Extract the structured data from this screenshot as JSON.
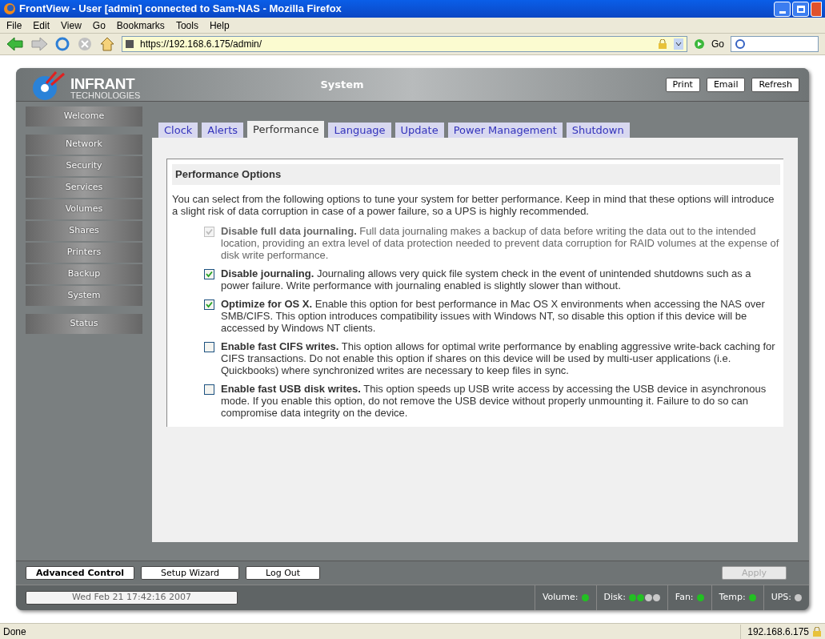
{
  "window": {
    "title": "FrontView - User [admin] connected to Sam-NAS - Mozilla Firefox"
  },
  "menu": [
    "File",
    "Edit",
    "View",
    "Go",
    "Bookmarks",
    "Tools",
    "Help"
  ],
  "address_bar": {
    "value": "https://192.168.6.175/admin/",
    "go": "Go"
  },
  "logo": {
    "name": "INFRANT",
    "sub": "TECHNOLOGIES"
  },
  "header": {
    "title": "System",
    "buttons": [
      "Print",
      "Email",
      "Refresh"
    ]
  },
  "sidebar": {
    "groups": [
      {
        "items": [
          {
            "label": "Welcome"
          }
        ]
      },
      {
        "items": [
          {
            "label": "Network"
          },
          {
            "label": "Security"
          },
          {
            "label": "Services"
          },
          {
            "label": "Volumes"
          },
          {
            "label": "Shares"
          },
          {
            "label": "Printers"
          },
          {
            "label": "Backup"
          },
          {
            "label": "System"
          }
        ]
      },
      {
        "items": [
          {
            "label": "Status"
          }
        ]
      }
    ]
  },
  "tabs": [
    {
      "label": "Clock",
      "selected": false
    },
    {
      "label": "Alerts",
      "selected": false
    },
    {
      "label": "Performance",
      "selected": true
    },
    {
      "label": "Language",
      "selected": false
    },
    {
      "label": "Update",
      "selected": false
    },
    {
      "label": "Power Management",
      "selected": false
    },
    {
      "label": "Shutdown",
      "selected": false
    }
  ],
  "section": {
    "title": "Performance Options",
    "intro": "You can select from the following options to tune your system for better performance. Keep in mind that these options will introduce a slight risk of data corruption in case of a power failure, so a UPS is highly recommended."
  },
  "options": [
    {
      "text": "**Disable full data journaling.** Full data journaling makes a backup of data before writing the data out to the intended location, providing an extra level of data protection needed to prevent data corruption for RAID volumes at the expense of disk write performance.",
      "checked": true,
      "disabled": true
    },
    {
      "text": "**Disable journaling.** Journaling allows very quick file system check in the event of unintended shutdowns such as a power failure. Write performance with journaling enabled is slightly slower than without.",
      "checked": true,
      "disabled": false
    },
    {
      "text": "**Optimize for OS X.** Enable this option for best performance in Mac OS X environments when accessing the NAS over SMB/CIFS. This option introduces compatibility issues with Windows NT, so disable this option if this device will be accessed by Windows NT clients.",
      "checked": true,
      "disabled": false
    },
    {
      "text": "**Enable fast CIFS writes.** This option allows for optimal write performance by enabling aggressive write-back caching for CIFS transactions. Do not enable this option if shares on this device will be used by multi-user applications (i.e. Quickbooks) where synchronized writes are necessary to keep files in sync.",
      "checked": false,
      "disabled": false
    },
    {
      "text": "**Enable fast USB disk writes.** This option speeds up USB write access by accessing the USB device in asynchronous mode. If you enable this option, do not remove the USB device without properly unmounting it. Failure to do so can compromise data integrity on the device.",
      "checked": false,
      "disabled": false
    }
  ],
  "footer_buttons": [
    {
      "label": "Advanced Control",
      "selected": true
    },
    {
      "label": "Setup Wizard",
      "selected": false
    },
    {
      "label": "Log Out",
      "selected": false
    }
  ],
  "apply": {
    "label": "Apply",
    "disabled": true
  },
  "datetime": "Wed Feb 21 17:42:16 2007",
  "indicators": [
    {
      "label": "Volume:",
      "dots": [
        {
          "color": "#22c022"
        }
      ]
    },
    {
      "label": "Disk:",
      "dots": [
        {
          "color": "#22c022"
        },
        {
          "color": "#22c022"
        },
        {
          "color": "#c8c8c8"
        },
        {
          "color": "#c8c8c8"
        }
      ]
    },
    {
      "label": "Fan:",
      "dots": [
        {
          "color": "#22c022"
        }
      ]
    },
    {
      "label": "Temp:",
      "dots": [
        {
          "color": "#22c022"
        }
      ]
    },
    {
      "label": "UPS:",
      "dots": [
        {
          "color": "#c8c8c8"
        }
      ]
    }
  ],
  "status_bar": {
    "text": "Done",
    "host": "192.168.6.175"
  }
}
